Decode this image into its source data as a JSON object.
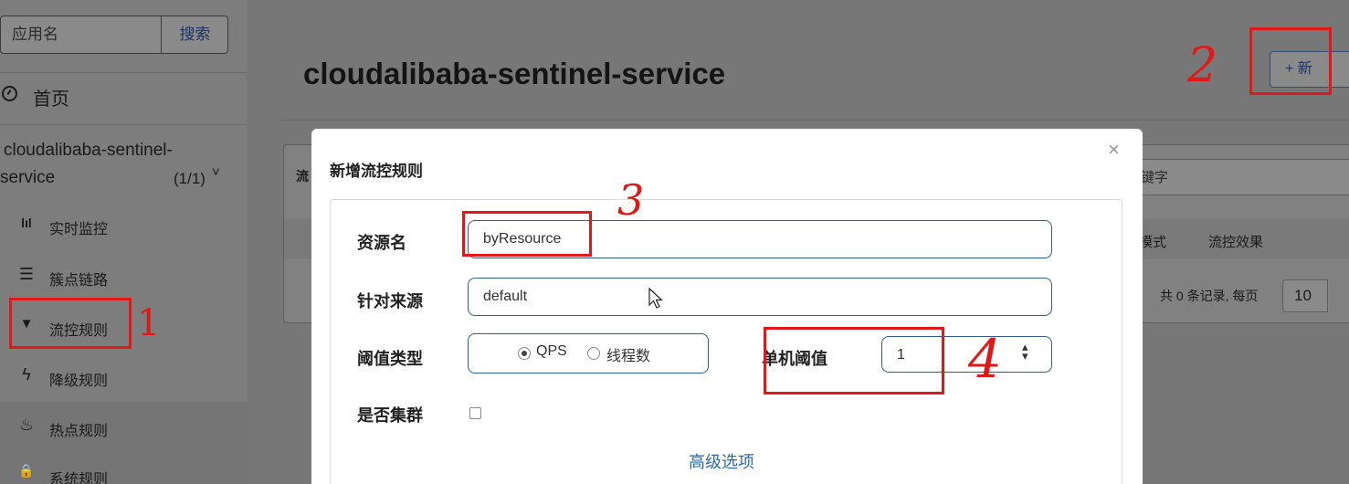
{
  "sidebar": {
    "search_placeholder": "应用名",
    "search_button": "搜索",
    "home_label": "首页",
    "app_name_line1": "cloudalibaba-sentinel-",
    "app_name_line2": "service",
    "app_count": "(1/1)",
    "app_chevron": "˅",
    "menu": [
      {
        "label": "实时监控",
        "icon": "bar-chart-icon",
        "glyph": "lıl"
      },
      {
        "label": "簇点链路",
        "icon": "list-icon",
        "glyph": "☰"
      },
      {
        "label": "流控规则",
        "icon": "filter-icon",
        "glyph": "▼"
      },
      {
        "label": "降级规则",
        "icon": "flash-icon",
        "glyph": "ϟ"
      },
      {
        "label": "热点规则",
        "icon": "fire-icon",
        "glyph": "♨"
      },
      {
        "label": "系统规则",
        "icon": "lock-icon",
        "glyph": "🔒"
      }
    ]
  },
  "main": {
    "title": "cloudalibaba-sentinel-service",
    "add_button": "+ 新",
    "panel_heading": "流",
    "keyword_placeholder": "键字",
    "columns": [
      "模式",
      "流控效果"
    ],
    "pagination_text": "共 0 条记录, 每页",
    "page_size": "10"
  },
  "modal": {
    "title": "新增流控规则",
    "close": "×",
    "fields": {
      "resource_label": "资源名",
      "resource_value": "byResource",
      "source_label": "针对来源",
      "source_value": "default",
      "grade_label": "阈值类型",
      "grade_options": [
        "QPS",
        "线程数"
      ],
      "grade_selected": "QPS",
      "count_label": "单机阈值",
      "count_value": "1",
      "cluster_label": "是否集群",
      "cluster_checked": false
    },
    "advanced_link": "高级选项"
  },
  "annotations": [
    "1",
    "2",
    "3",
    "4"
  ],
  "colors": {
    "overlay_dim": "#777777",
    "modal_bg": "#ffffff",
    "input_border": "#2c5e91",
    "link": "#2a6aae",
    "annotation_red": "#e01818"
  }
}
